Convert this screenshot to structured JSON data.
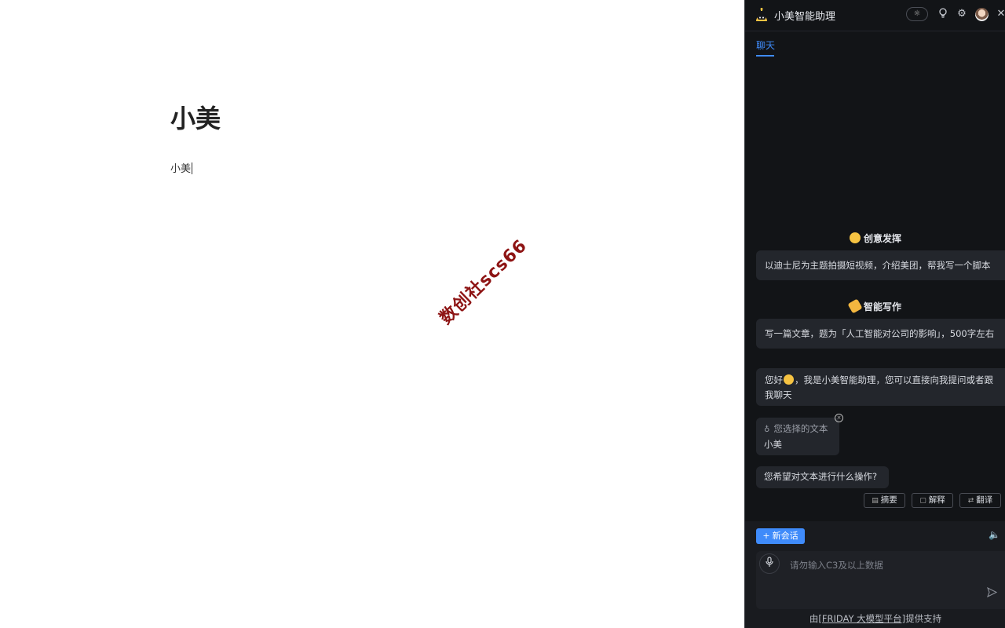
{
  "document": {
    "title": "小美",
    "body": "小美",
    "watermark": "数创社scs66"
  },
  "assistant": {
    "title": "小美智能助理",
    "header_icons": [
      "theme-toggle-icon",
      "bulb-icon",
      "gear-icon",
      "avatar",
      "close-icon"
    ],
    "tabs": [
      {
        "label": "聊天",
        "active": true
      }
    ],
    "sections": [
      {
        "heading": "创意发挥",
        "prompt": "以迪士尼为主题拍摄短视频，介绍美团，帮我写一个脚本"
      },
      {
        "heading": "智能写作",
        "prompt": "写一篇文章，题为「人工智能对公司的影响」，500字左右"
      }
    ],
    "greeting_before_emoji": "您好",
    "greeting_after_emoji": "，我是小美智能助理，您可以直接向我提问或者跟我聊天",
    "selection": {
      "label": "您选择的文本",
      "text": "小美"
    },
    "question": "您希望对文本进行什么操作?",
    "actions": [
      "摘要",
      "解释",
      "翻译"
    ],
    "new_chat_label": "新会话",
    "input_placeholder": "请勿输入C3及以上数据",
    "footer": {
      "prefix": "由",
      "link": "[FRIDAY 大模型平台]",
      "suffix": "提供支持"
    }
  },
  "colors": {
    "accent": "#3f8bfa",
    "panel_bg": "#121417",
    "card_bg": "#23262c",
    "watermark": "#8e1414"
  }
}
